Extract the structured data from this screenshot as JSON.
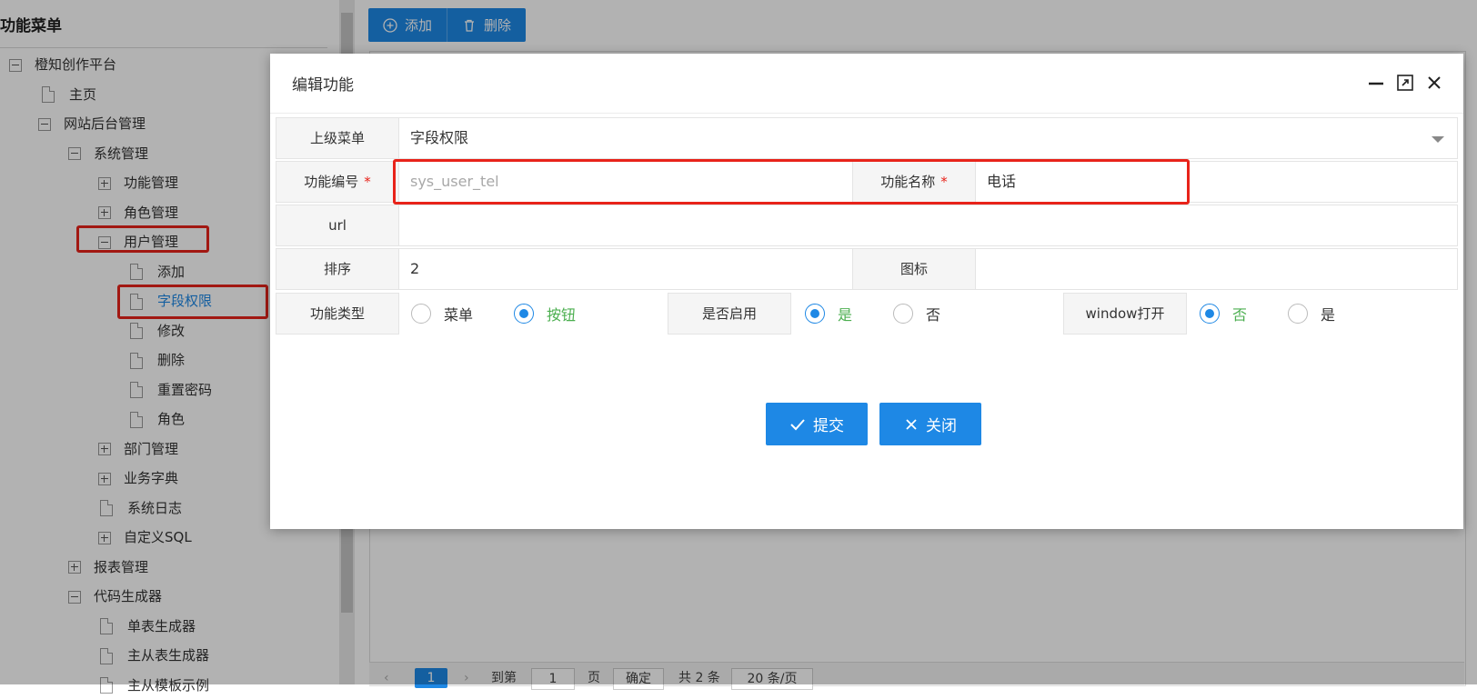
{
  "sidebar": {
    "title": "功能菜单",
    "tree": [
      {
        "label": "橙知创作平台",
        "type": "minus"
      },
      {
        "label": "主页",
        "type": "file"
      },
      {
        "label": "网站后台管理",
        "type": "minus"
      },
      {
        "label": "系统管理",
        "type": "minus"
      },
      {
        "label": "功能管理",
        "type": "plus"
      },
      {
        "label": "角色管理",
        "type": "plus"
      },
      {
        "label": "用户管理",
        "type": "minus"
      },
      {
        "label": "添加",
        "type": "file"
      },
      {
        "label": "字段权限",
        "type": "file",
        "active": true
      },
      {
        "label": "修改",
        "type": "file"
      },
      {
        "label": "删除",
        "type": "file"
      },
      {
        "label": "重置密码",
        "type": "file"
      },
      {
        "label": "角色",
        "type": "file"
      },
      {
        "label": "部门管理",
        "type": "plus"
      },
      {
        "label": "业务字典",
        "type": "plus"
      },
      {
        "label": "系统日志",
        "type": "file"
      },
      {
        "label": "自定义SQL",
        "type": "plus"
      },
      {
        "label": "报表管理",
        "type": "plus"
      },
      {
        "label": "代码生成器",
        "type": "minus"
      },
      {
        "label": "单表生成器",
        "type": "file"
      },
      {
        "label": "主从表生成器",
        "type": "file"
      },
      {
        "label": "主从模板示例",
        "type": "file"
      }
    ]
  },
  "toolbar": {
    "add_label": "添加",
    "delete_label": "删除"
  },
  "pager": {
    "page": "1",
    "goto_label": "到第",
    "goto_value": "1",
    "page_unit": "页",
    "confirm_label": "确定",
    "total_label": "共 2 条",
    "page_size": "20 条/页"
  },
  "dialog": {
    "title": "编辑功能",
    "parent_menu_label": "上级菜单",
    "parent_menu_value": "字段权限",
    "func_code_label": "功能编号",
    "func_code_placeholder": "sys_user_tel",
    "func_name_label": "功能名称",
    "func_name_value": "电话",
    "required_mark": "*",
    "url_label": "url",
    "url_value": "",
    "sort_label": "排序",
    "sort_value": "2",
    "icon_label": "图标",
    "icon_value": "",
    "func_type_label": "功能类型",
    "func_type_options": [
      "菜单",
      "按钮"
    ],
    "func_type_selected": "按钮",
    "enabled_label": "是否启用",
    "enabled_options": [
      "是",
      "否"
    ],
    "enabled_selected": "是",
    "window_label": "window打开",
    "window_options": [
      "否",
      "是"
    ],
    "window_selected": "否",
    "submit_label": "提交",
    "close_label": "关闭"
  },
  "colors": {
    "accent": "#1e88e5",
    "highlight": "#e8231a",
    "selected_text": "#4caf50"
  }
}
